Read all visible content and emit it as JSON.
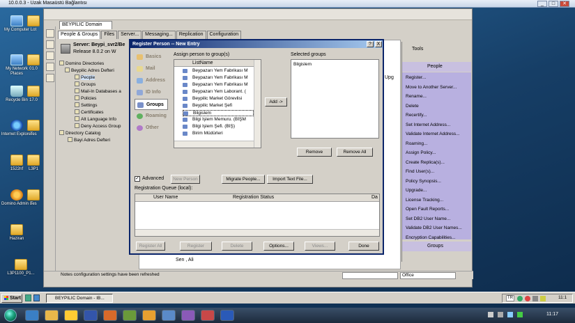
{
  "rdp": {
    "title": "10.0.0.3 - Uzak Masaüstü Bağlantısı",
    "minimize": "_",
    "maximize": "□",
    "close": "✕"
  },
  "desktop_icons": [
    {
      "label": "My Computer",
      "icon": "computer-icon"
    },
    {
      "label": "Lot",
      "icon": "lotus-icon"
    },
    {
      "label": "My Network Places",
      "icon": "network-icon"
    },
    {
      "label": "01.0",
      "icon": "file-icon"
    },
    {
      "label": "Recycle Bin",
      "icon": "recycle-bin-icon"
    },
    {
      "label": "17.0",
      "icon": "file-icon"
    },
    {
      "label": "Internet Explorer",
      "icon": "ie-icon"
    },
    {
      "label": "Tes",
      "icon": "file-icon"
    },
    {
      "label": "1522nf",
      "icon": "folder-icon"
    },
    {
      "label": "L3P1",
      "icon": "folder-icon"
    },
    {
      "label": "Domino Admin 8",
      "icon": "domino-admin-icon"
    },
    {
      "label": "Tes",
      "icon": "file-icon"
    },
    {
      "label": "Haziran",
      "icon": "folder-icon"
    },
    {
      "label": "L3P1100_P1...",
      "icon": "folder-icon"
    }
  ],
  "notes": {
    "tab_title": "BEYPILIC Domain",
    "tabs": [
      "People & Groups",
      "Files",
      "Server...",
      "Messaging...",
      "Replication",
      "Configuration"
    ],
    "server_label": "Server:",
    "server_name": "Beypi_svr2/Be",
    "server_release": "Release 8.0.2 on W",
    "tree": [
      "Domino Directories",
      "Beypilic Adres Defteri",
      "People",
      "Groups",
      "Mail-In Databases a",
      "Policies",
      "Settings",
      "Certificates",
      "Alt Language Info",
      "Deny Access Group",
      "Directory Catalog",
      "Bayi Adres Defteri"
    ],
    "upg": "Upg",
    "row_text": "Sen , Ali",
    "status_text": "Notes configuration settings have been refreshed",
    "status_location": "Office"
  },
  "tools": {
    "header": "Tools",
    "people_header": "People",
    "items": [
      "Register...",
      "Move to Another Server...",
      "Rename...",
      "Delete",
      "Recertify...",
      "Set Internet Address...",
      "Validate Internet Address...",
      "Roaming...",
      "Assign Policy...",
      "Create Replica(s)...",
      "Find User(s)...",
      "Policy Synopsis...",
      "Upgrade...",
      "License Tracking...",
      "Open Fault Reports...",
      "Set DB2 User Name...",
      "Validate DB2 User Names...",
      "Encryption Capabilities..."
    ],
    "groups_header": "Groups"
  },
  "dialog": {
    "title": "Register Person -- New Entry",
    "help_btn": "?",
    "close_btn": "X",
    "nav": [
      "Basics",
      "Mail",
      "Address",
      "ID Info",
      "Groups",
      "Roaming",
      "Other"
    ],
    "assign_label": "Assign person to group(s)",
    "selected_label": "Selected groups",
    "list_header": "ListName",
    "groups": [
      "Beypazarı Yem Fabrikası M",
      "Beypazarı Yem Fabrikası M",
      "Beypazarı Yem Fabrikası M",
      "Beypazarı Yem Laborant. (",
      "Beypilic Market Görevlisi",
      "Beypilic Market Şefi",
      "Bilgislem",
      "Bilgi İşlem Memuru. (BİŞM",
      "Bilgi İşlem Şefi. (BİŞ)",
      "Birim Müdürleri"
    ],
    "selected_groups": [
      "Bilgislem"
    ],
    "add_btn": "Add ->",
    "remove_btn": "Remove",
    "remove_all_btn": "Remove All",
    "advanced_label": "Advanced",
    "new_person_btn": "New Person",
    "migrate_btn": "Migrate People...",
    "import_btn": "Import Text File...",
    "queue_label": "Registration Queue (local):",
    "queue_cols": [
      "User Name",
      "Registration Status",
      "Da"
    ],
    "register_all_btn": "Register All",
    "register_btn": "Register",
    "delete_btn": "Delete",
    "options_btn": "Options...",
    "views_btn": "Views...",
    "done_btn": "Done"
  },
  "taskbar": {
    "start_label": "Start",
    "active_task": "BEYPILIC Domain - IB...",
    "lang": "TR",
    "clock_inner": "11:1",
    "clock_outer": "11:17"
  }
}
